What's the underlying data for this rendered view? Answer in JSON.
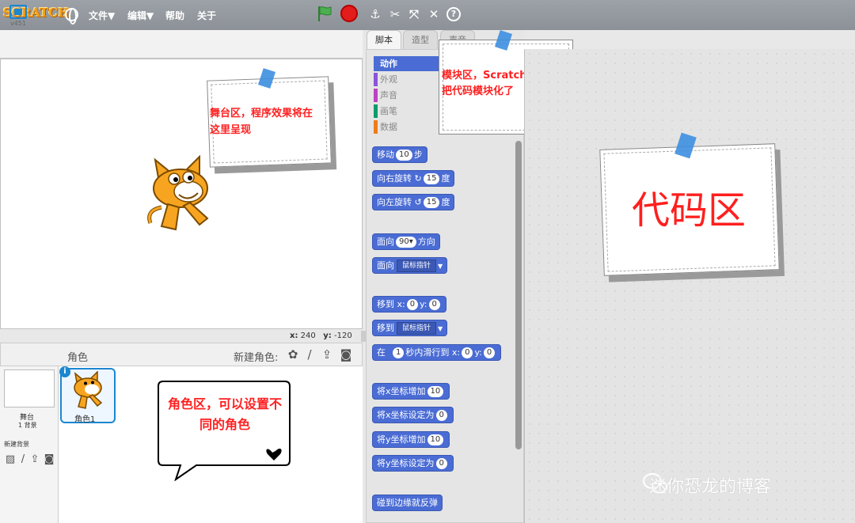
{
  "app": {
    "logo": "SCRATCH",
    "version": "v451"
  },
  "menu": {
    "file": "文件▼",
    "edit": "编辑▼",
    "help": "帮助",
    "about": "关于"
  },
  "stage": {
    "coord_x_label": "x:",
    "coord_x": "240",
    "coord_y_label": "y:",
    "coord_y": "-120",
    "note": "舞台区，程序效果将在这里呈现"
  },
  "sprites": {
    "header": "角色",
    "new_sprite": "新建角色:",
    "stage_label": "舞台",
    "stage_bg_count": "1 背景",
    "new_backdrop": "新建背景",
    "sprite1_name": "角色1",
    "note": "角色区，可以设置不同的角色"
  },
  "tabs": {
    "scripts": "脚本",
    "costumes": "造型",
    "sounds": "声音"
  },
  "categories": [
    {
      "label": "动作",
      "color": "#4a6cd4"
    },
    {
      "label": "外观",
      "color": "#8a55d7"
    },
    {
      "label": "声音",
      "color": "#bb42c3"
    },
    {
      "label": "画笔",
      "color": "#0e9a6c"
    },
    {
      "label": "数据",
      "color": "#ee7d16"
    }
  ],
  "palette_note": "模块区，Scratch的亮点，把代码模块化了",
  "blocks": {
    "move": "移动",
    "move_val": "10",
    "move_unit": "步",
    "turn_right": "向右旋转",
    "turn_right_val": "15",
    "turn_right_unit": "度",
    "turn_left": "向左旋转",
    "turn_left_val": "15",
    "turn_left_unit": "度",
    "point_dir": "面向",
    "point_dir_val": "90▾",
    "point_dir_unit": "方向",
    "point_toward": "面向",
    "point_toward_val": "鼠标指针",
    "goto_xy": "移到",
    "goto_xy_x": "0",
    "goto_xy_y": "0",
    "goto": "移到",
    "goto_val": "鼠标指针",
    "glide_pre": "在",
    "glide_secs": "1",
    "glide_mid": "秒内滑行到",
    "glide_x": "0",
    "glide_y": "0",
    "change_x": "将x坐标增加",
    "change_x_val": "10",
    "set_x": "将x坐标设定为",
    "set_x_val": "0",
    "change_y": "将y坐标增加",
    "change_y_val": "10",
    "set_y": "将y坐标设定为",
    "set_y_val": "0",
    "bounce": "碰到边缘就反弹",
    "x": "x:",
    "y": "y:"
  },
  "script_area": {
    "note": "代码区"
  },
  "watermark": "迷你恐龙的博客"
}
